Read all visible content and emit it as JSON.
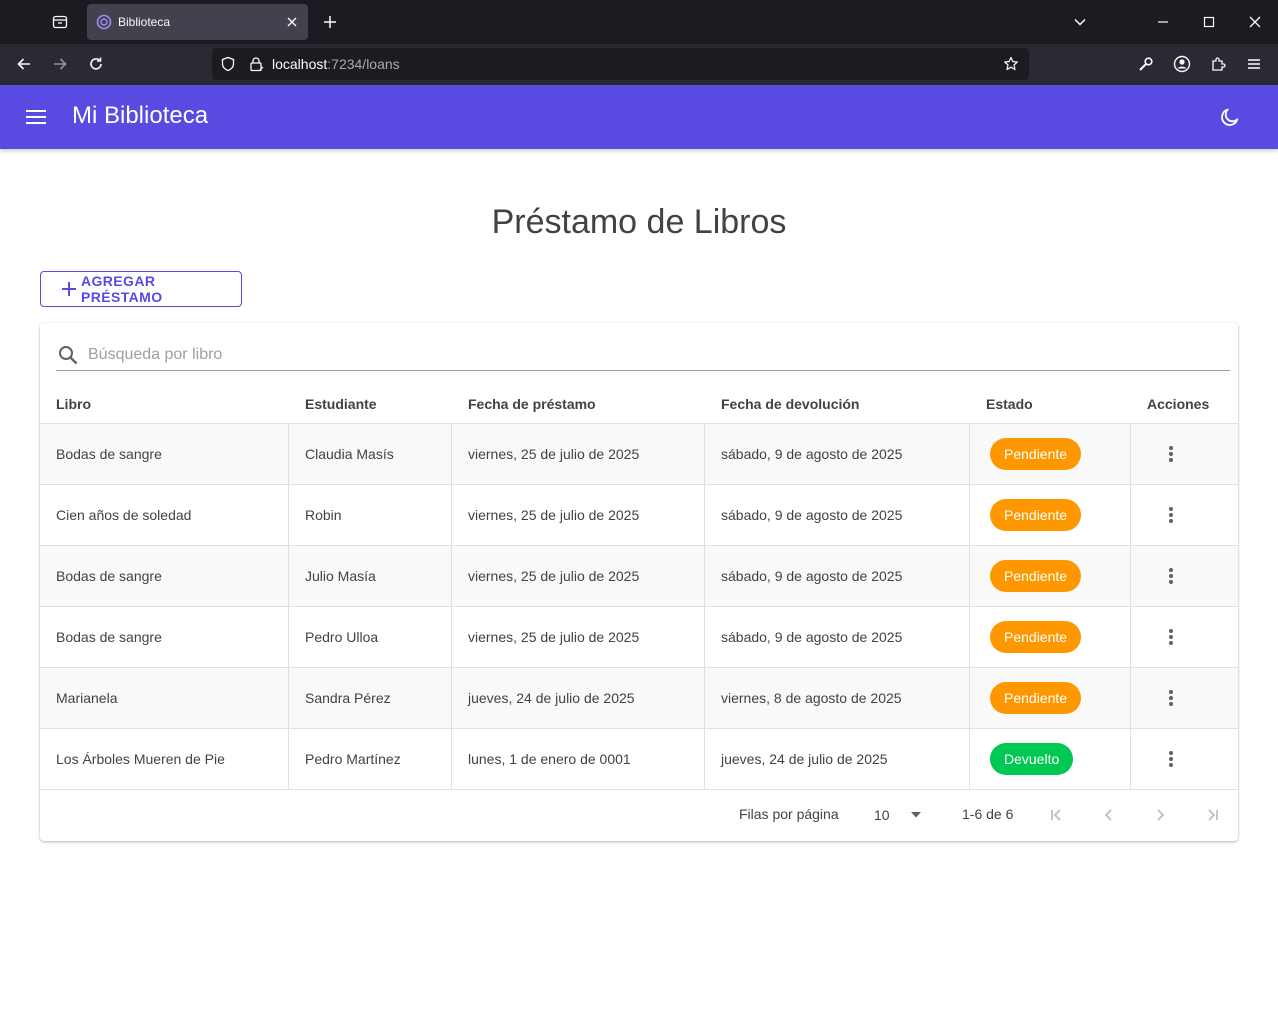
{
  "browser": {
    "tab_title": "Biblioteca",
    "url_host": "localhost",
    "url_path": ":7234/loans"
  },
  "app": {
    "title": "Mi Biblioteca"
  },
  "page": {
    "title": "Préstamo de Libros",
    "add_button_label": "AGREGAR PRÉSTAMO"
  },
  "search": {
    "placeholder": "Búsqueda por libro",
    "value": ""
  },
  "table": {
    "headers": [
      "Libro",
      "Estudiante",
      "Fecha de préstamo",
      "Fecha de devolución",
      "Estado",
      "Acciones"
    ],
    "rows": [
      {
        "libro": "Bodas de sangre",
        "estudiante": "Claudia Masís",
        "prestamo": "viernes, 25 de julio de 2025",
        "devolucion": "sábado, 9 de agosto de 2025",
        "estado": "Pendiente"
      },
      {
        "libro": "Cien años de soledad",
        "estudiante": "Robin",
        "prestamo": "viernes, 25 de julio de 2025",
        "devolucion": "sábado, 9 de agosto de 2025",
        "estado": "Pendiente"
      },
      {
        "libro": "Bodas de sangre",
        "estudiante": "Julio Masía",
        "prestamo": "viernes, 25 de julio de 2025",
        "devolucion": "sábado, 9 de agosto de 2025",
        "estado": "Pendiente"
      },
      {
        "libro": "Bodas de sangre",
        "estudiante": "Pedro Ulloa",
        "prestamo": "viernes, 25 de julio de 2025",
        "devolucion": "sábado, 9 de agosto de 2025",
        "estado": "Pendiente"
      },
      {
        "libro": "Marianela",
        "estudiante": "Sandra Pérez",
        "prestamo": "jueves, 24 de julio de 2025",
        "devolucion": "viernes, 8 de agosto de 2025",
        "estado": "Pendiente"
      },
      {
        "libro": "Los Árboles Mueren de Pie",
        "estudiante": "Pedro Martínez",
        "prestamo": "lunes, 1 de enero de 0001",
        "devolucion": "jueves, 24 de julio de 2025",
        "estado": "Devuelto"
      }
    ]
  },
  "pager": {
    "rows_per_page_label": "Filas por página",
    "rows_per_page_value": "10",
    "range_text": "1-6 de 6"
  },
  "colors": {
    "primary": "#594ae2",
    "pending": "#ff9800",
    "returned": "#00c853"
  }
}
